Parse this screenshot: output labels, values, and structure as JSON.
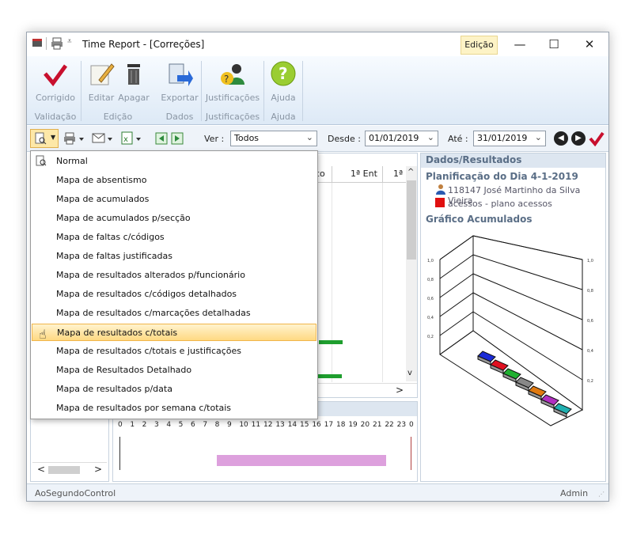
{
  "window": {
    "title": "Time Report - [Correções]",
    "active_tab": "Edição"
  },
  "ribbon": {
    "buttons": [
      {
        "label": "Corrigido",
        "icon": "checkmark-icon"
      },
      {
        "label": "Editar",
        "icon": "edit-icon"
      },
      {
        "label": "Apagar",
        "icon": "trash-icon"
      },
      {
        "label": "Exportar",
        "icon": "export-icon"
      },
      {
        "label": "Justificações",
        "icon": "justifications-icon"
      },
      {
        "label": "Ajuda",
        "icon": "help-icon"
      }
    ],
    "groups": [
      "Validação",
      "Edição",
      "Dados",
      "Justificações",
      "Ajuda"
    ]
  },
  "toolbar": {
    "ver_label": "Ver :",
    "ver_value": "Todos",
    "desde_label": "Desde :",
    "desde_value": "01/01/2019",
    "ate_label": "Até :",
    "ate_value": "31/01/2019"
  },
  "grid": {
    "columns": [
      "co",
      "1ª Ent",
      "1ª"
    ]
  },
  "timeline": {
    "hours": [
      "0",
      "1",
      "2",
      "3",
      "4",
      "5",
      "6",
      "7",
      "8",
      "9",
      "10",
      "11",
      "12",
      "13",
      "14",
      "15",
      "16",
      "17",
      "18",
      "19",
      "20",
      "21",
      "22",
      "23",
      "0"
    ]
  },
  "results": {
    "header": "Dados/Resultados",
    "plan_title": "Planificação do Dia 4-1-2019",
    "employee": "118147 José Martinho da Silva Vieira",
    "legend": "acessos - plano acessos",
    "chart_title": "Gráfico Acumulados"
  },
  "chart_data": {
    "type": "bar",
    "title": "Gráfico Acumulados",
    "left_axis_ticks": [
      "0,2",
      "0,4",
      "0,6",
      "0,8",
      "1,0"
    ],
    "right_axis_ticks": [
      "0,2",
      "0,4",
      "0,6",
      "0,8",
      "1,0"
    ],
    "series_colors": [
      "#1a2bd6",
      "#e01020",
      "#20b030",
      "#888888",
      "#e07a10",
      "#b030c0",
      "#20b0b0"
    ],
    "ylim": [
      0,
      1.0
    ]
  },
  "menu": {
    "items": [
      "Normal",
      "Mapa de absentismo",
      "Mapa de acumulados",
      "Mapa de acumulados p/secção",
      "Mapa de faltas c/códigos",
      "Mapa de faltas justificadas",
      "Mapa de resultados alterados p/funcionário",
      "Mapa de resultados c/códigos detalhados",
      "Mapa de resultados c/marcações detalhadas",
      "Mapa de resultados c/totais",
      "Mapa de resultados c/totais e justificações",
      "Mapa de Resultados Detalhado",
      "Mapa de resultados p/data",
      "Mapa de resultados por semana c/totais"
    ],
    "highlighted_index": 9
  },
  "status": {
    "left": "AoSegundoControl",
    "right": "Admin"
  },
  "colors": {
    "accent_tab": "#fdf3c6",
    "menu_highlight": "#ffd982",
    "bar_green": "#1e9e2e",
    "timeline_bar": "#dda0dd"
  }
}
